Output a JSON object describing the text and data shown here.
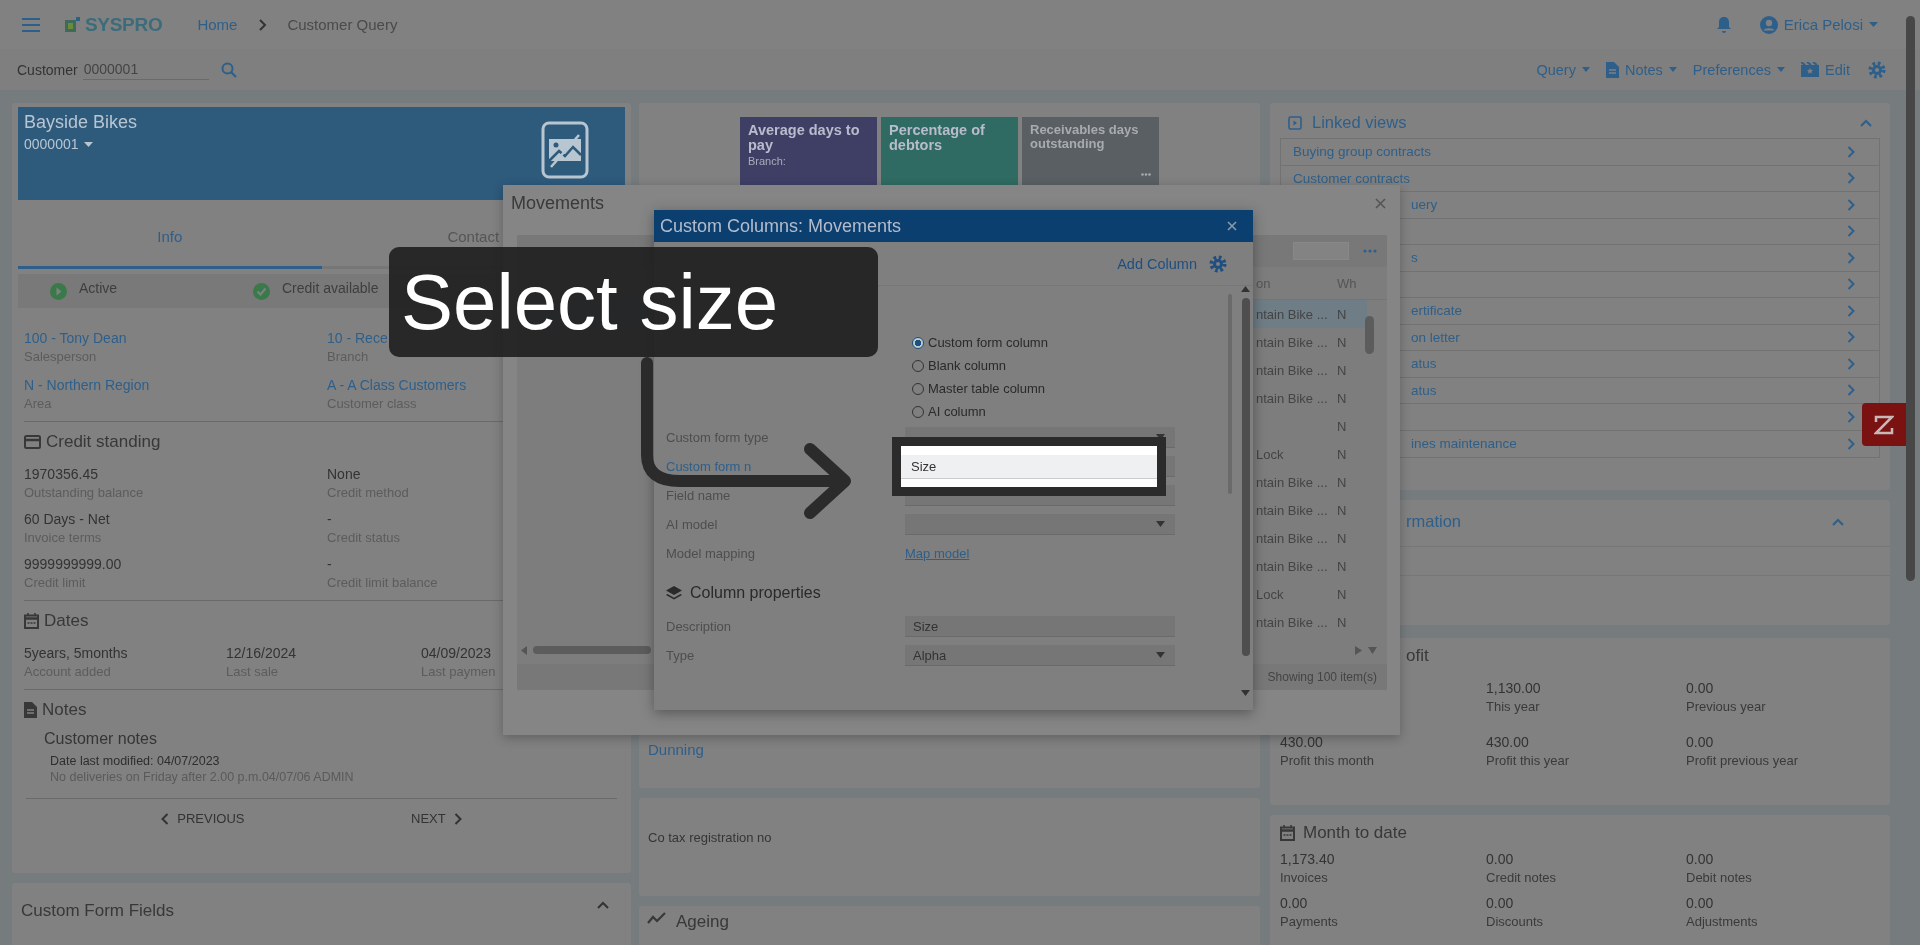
{
  "top_bar": {
    "logo": "SYSPRO",
    "breadcrumb": [
      {
        "label": "Home",
        "kind": "link"
      },
      {
        "label": "Customer Query",
        "kind": "current"
      }
    ],
    "user": "Erica Pelosi"
  },
  "customer_search": {
    "label": "Customer",
    "value": "0000001"
  },
  "toolbar": [
    {
      "label": "Query",
      "dropdown": true
    },
    {
      "label": "Notes",
      "dropdown": true
    },
    {
      "label": "Preferences",
      "dropdown": true
    },
    {
      "label": "Edit",
      "dropdown": false
    }
  ],
  "customer_card": {
    "name": "Bayside Bikes",
    "code": "0000001"
  },
  "tabs": [
    {
      "label": "Info",
      "selected": true
    },
    {
      "label": "Contact",
      "selected": false
    }
  ],
  "status": [
    {
      "label": "Active",
      "kind": "active"
    },
    {
      "label": "Credit available",
      "kind": "ok"
    }
  ],
  "info_fields": [
    {
      "value": "100 - Tony Dean",
      "label": "Salesperson"
    },
    {
      "value": "10 - Rece",
      "label": "Branch"
    },
    {
      "value": "N - Northern Region",
      "label": "Area"
    },
    {
      "value": "A - A Class Customers",
      "label": "Customer class"
    }
  ],
  "credit_standing": {
    "title": "Credit standing",
    "fields": [
      {
        "value": "1970356.45",
        "label": "Outstanding balance"
      },
      {
        "value": "None",
        "label": "Credit method"
      },
      {
        "value": "60 Days - Net",
        "label": "Invoice terms"
      },
      {
        "value": "-",
        "label": "Credit status"
      },
      {
        "value": "9999999999.00",
        "label": "Credit limit"
      },
      {
        "value": "-",
        "label": "Credit limit balance"
      }
    ]
  },
  "dates": {
    "title": "Dates",
    "fields": [
      {
        "value": "5years, 5months",
        "label": "Account added"
      },
      {
        "value": "12/16/2024",
        "label": "Last sale"
      },
      {
        "value": "04/09/2023",
        "label": "Last paymen"
      }
    ]
  },
  "notes": {
    "title": "Notes",
    "subtitle": "Customer notes",
    "modified": "Date last modified: 04/07/2023",
    "text": "No deliveries on Friday after 2.00 p.m.04/07/06 ADMIN"
  },
  "pager": {
    "previous": "PREVIOUS",
    "next": "NEXT"
  },
  "custom_form_fields": {
    "title": "Custom Form Fields",
    "expanded": true
  },
  "tiles": [
    {
      "title": "Average days to pay",
      "subtitle": "Branch:",
      "color": "#3f3f66",
      "more": false
    },
    {
      "title": "Percentage of debtors",
      "color": "#2f6b62",
      "more": false
    },
    {
      "title": "Receivables days outstanding",
      "color": "#5a5f63",
      "more": true
    }
  ],
  "dunning": "Dunning",
  "tax_registration": "Co tax registration no",
  "ageing": {
    "title": "Ageing"
  },
  "linked_views": {
    "title": "Linked views",
    "expanded": true,
    "items": [
      {
        "label": "Buying group contracts",
        "chevron": true
      },
      {
        "label": "Customer contracts",
        "chevron": true
      },
      {
        "label": "uery",
        "chevron": true
      },
      {
        "chevron": true
      },
      {
        "label": "s",
        "chevron": true
      },
      {
        "chevron": true
      },
      {
        "label": "ertificate",
        "chevron": true
      },
      {
        "label": "on letter",
        "chevron": true
      },
      {
        "label": "atus",
        "chevron": true
      },
      {
        "label": "atus",
        "chevron": true
      },
      {
        "chevron": true
      },
      {
        "label": "ines maintenance",
        "chevron": true
      }
    ]
  },
  "business_info": {
    "title": "rmation",
    "expanded": true
  },
  "profit": {
    "title": "ofit",
    "items": [
      {
        "value": "1,130.00",
        "label": "This year"
      },
      {
        "value": "0.00",
        "label": "Previous year"
      },
      {
        "value": "430.00",
        "label": "Profit this month"
      },
      {
        "value": "430.00",
        "label": "Profit this year"
      },
      {
        "value": "0.00",
        "label": "Profit previous year"
      }
    ]
  },
  "month_to_date": {
    "title": "Month to date",
    "items": [
      {
        "value": "1,173.40",
        "label": "Invoices"
      },
      {
        "value": "0.00",
        "label": "Credit notes"
      },
      {
        "value": "0.00",
        "label": "Debit notes"
      },
      {
        "value": "0.00",
        "label": "Payments"
      },
      {
        "value": "0.00",
        "label": "Discounts"
      },
      {
        "value": "0.00",
        "label": "Adjustments"
      }
    ]
  },
  "movements": {
    "title": "Movements",
    "columns": [
      "on",
      "Wh"
    ],
    "rows": [
      {
        "column_1": "ntain Bike ...",
        "wh": "N",
        "selected": true
      },
      {
        "column_1": "ntain Bike ...",
        "wh": "N",
        "selected": false
      },
      {
        "column_1": "ntain Bike ...",
        "wh": "N",
        "selected": false
      },
      {
        "column_1": "ntain Bike ...",
        "wh": "N",
        "selected": false
      },
      {
        "wh": "N",
        "selected": false
      },
      {
        "column_1": "Lock",
        "wh": "N",
        "selected": false
      },
      {
        "column_1": "ntain Bike ...",
        "wh": "N",
        "selected": false
      },
      {
        "column_1": "ntain Bike ...",
        "wh": "N",
        "selected": false
      },
      {
        "column_1": "ntain Bike ...",
        "wh": "N",
        "selected": false
      },
      {
        "column_1": "ntain Bike ...",
        "wh": "N",
        "selected": false
      },
      {
        "column_1": "Lock",
        "wh": "N",
        "selected": false
      },
      {
        "column_1": "ntain Bike ...",
        "wh": "N",
        "selected": false
      }
    ],
    "footer": "Showing 100 item(s)"
  },
  "dialog": {
    "title": "Custom Columns: Movements",
    "add_button": "Add Column",
    "column_types": [
      {
        "label": "Custom form column",
        "selected": true
      },
      {
        "label": "Blank column",
        "selected": false
      },
      {
        "label": "Master table column",
        "selected": false
      },
      {
        "label": "AI column",
        "selected": false
      }
    ],
    "fields": [
      {
        "label": "Custom form type",
        "kind": "select",
        "focused": false
      },
      {
        "label": "Custom form n",
        "kind": "select",
        "focused": true
      },
      {
        "label": "Field name",
        "kind": "input",
        "focused": false
      },
      {
        "label": "AI model",
        "kind": "select",
        "focused": false
      },
      {
        "label": "Model mapping",
        "kind": "link",
        "link": "Map model",
        "focused": false
      }
    ],
    "properties_heading": "Column properties",
    "properties": [
      {
        "label": "Description",
        "kind": "input",
        "value": "Size"
      },
      {
        "label": "Type",
        "kind": "select",
        "value": "Alpha"
      }
    ]
  },
  "dropdown": {
    "options": [
      {
        "label": "Size",
        "selected": true
      }
    ]
  },
  "callout": {
    "text": "Select size"
  }
}
